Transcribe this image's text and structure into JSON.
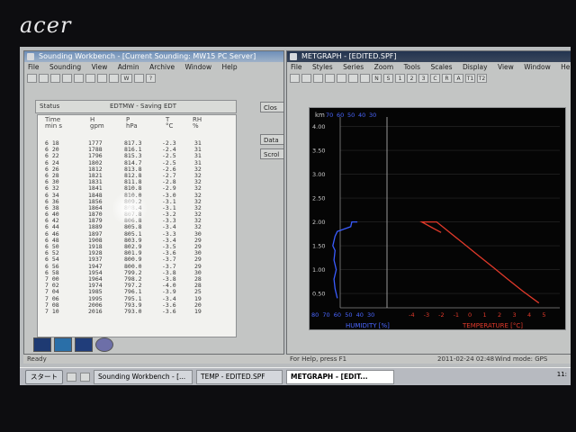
{
  "brand": "acer",
  "sounding": {
    "title": "Sounding Workbench - [Current Sounding: MW15 PC Server]",
    "menu": [
      "File",
      "Sounding",
      "View",
      "Admin",
      "Archive",
      "Window",
      "Help"
    ],
    "toolbar_w": "W",
    "status_label": "Status",
    "status_value": "EDTMW - Saving EDT",
    "buttons": {
      "close": "Clos",
      "data": "Data",
      "scroll": "Scrol"
    },
    "headers": {
      "time_top": "Time",
      "time_bot": "min  s",
      "h_top": "H",
      "h_bot": "gpm",
      "p_top": "P",
      "p_bot": "hPa",
      "t_top": "T",
      "t_bot": "°C",
      "rh_top": "RH",
      "rh_bot": "%"
    },
    "rows": [
      [
        "6 18",
        "1777",
        "817.3",
        "-2.3",
        "31"
      ],
      [
        "6 20",
        "1788",
        "816.1",
        "-2.4",
        "31"
      ],
      [
        "6 22",
        "1796",
        "815.3",
        "-2.5",
        "31"
      ],
      [
        "6 24",
        "1802",
        "814.7",
        "-2.5",
        "31"
      ],
      [
        "6 26",
        "1812",
        "813.8",
        "-2.6",
        "32"
      ],
      [
        "6 28",
        "1821",
        "812.8",
        "-2.7",
        "32"
      ],
      [
        "6 30",
        "1831",
        "811.8",
        "-2.8",
        "32"
      ],
      [
        "6 32",
        "1841",
        "810.8",
        "-2.9",
        "32"
      ],
      [
        "6 34",
        "1848",
        "810.0",
        "-3.0",
        "32"
      ],
      [
        "6 36",
        "1856",
        "809.2",
        "-3.1",
        "32"
      ],
      [
        "6 38",
        "1864",
        "808.4",
        "-3.1",
        "32"
      ],
      [
        "6 40",
        "1870",
        "807.8",
        "-3.2",
        "32"
      ],
      [
        "6 42",
        "1879",
        "806.8",
        "-3.3",
        "32"
      ],
      [
        "6 44",
        "1889",
        "805.8",
        "-3.4",
        "32"
      ],
      [
        "6 46",
        "1897",
        "805.1",
        "-3.3",
        "30"
      ],
      [
        "6 48",
        "1908",
        "803.9",
        "-3.4",
        "29"
      ],
      [
        "6 50",
        "1918",
        "802.9",
        "-3.5",
        "29"
      ],
      [
        "6 52",
        "1928",
        "801.9",
        "-3.6",
        "30"
      ],
      [
        "6 54",
        "1937",
        "800.9",
        "-3.7",
        "29"
      ],
      [
        "6 56",
        "1947",
        "800.0",
        "-3.7",
        "29"
      ],
      [
        "6 58",
        "1954",
        "799.2",
        "-3.8",
        "30"
      ],
      [
        "7 00",
        "1964",
        "798.2",
        "-3.8",
        "28"
      ],
      [
        "7 02",
        "1974",
        "797.2",
        "-4.0",
        "28"
      ],
      [
        "7 04",
        "1985",
        "796.1",
        "-3.9",
        "25"
      ],
      [
        "7 06",
        "1995",
        "795.1",
        "-3.4",
        "19"
      ],
      [
        "7 08",
        "2006",
        "793.9",
        "-3.6",
        "20"
      ],
      [
        "7 10",
        "2016",
        "793.0",
        "-3.6",
        "19"
      ]
    ]
  },
  "metgraph": {
    "title": "METGRAPH - [EDITED.SPF]",
    "menu": [
      "File",
      "Styles",
      "Series",
      "Zoom",
      "Tools",
      "Scales",
      "Display",
      "View",
      "Window",
      "Help"
    ],
    "toolbar": [
      "N",
      "S",
      "1",
      "2",
      "3",
      "C",
      "R",
      "A",
      "T1",
      "T2"
    ],
    "plot_mark": "km",
    "left_readout": [
      "70",
      "60",
      "50",
      "40",
      "30"
    ]
  },
  "chart_data": {
    "type": "line",
    "y_ticks": [
      "4.00",
      "3.50",
      "3.00",
      "2.50",
      "2.00",
      "1.50",
      "1.00",
      "0.50"
    ],
    "ylim": [
      0.2,
      4.2
    ],
    "humidity_ticks": [
      "80",
      "70",
      "60",
      "50",
      "40",
      "30"
    ],
    "humidity_lim": [
      80,
      30
    ],
    "xlabel_humidity": "HUMIDITY [%]",
    "temp_ticks": [
      "-4",
      "-3",
      "-2",
      "-1",
      "0",
      "1",
      "2",
      "3",
      "4",
      "5"
    ],
    "temp_lim": [
      -4.8,
      5.4
    ],
    "xlabel_temp": "TEMPERATURE [°C]",
    "series": [
      {
        "name": "HUMIDITY [%]",
        "color": "#3a5cff",
        "axis": "humidity",
        "points": [
          [
            60,
            0.4
          ],
          [
            62,
            0.6
          ],
          [
            63,
            0.8
          ],
          [
            61,
            1.0
          ],
          [
            63,
            1.2
          ],
          [
            62,
            1.4
          ],
          [
            64,
            1.5
          ],
          [
            62,
            1.7
          ],
          [
            60,
            1.8
          ],
          [
            48,
            1.9
          ],
          [
            47,
            2.0
          ],
          [
            42,
            2.0
          ]
        ]
      },
      {
        "name": "TEMPERATURE [°C]",
        "color": "#e0392a",
        "axis": "temp",
        "points": [
          [
            4.6,
            0.3
          ],
          [
            3.5,
            0.55
          ],
          [
            2.5,
            0.8
          ],
          [
            1.5,
            1.05
          ],
          [
            0.5,
            1.3
          ],
          [
            -0.5,
            1.55
          ],
          [
            -1.5,
            1.8
          ],
          [
            -2.3,
            2.0
          ],
          [
            -3.3,
            2.0
          ],
          [
            -2.6,
            1.88
          ],
          [
            -2.0,
            1.78
          ]
        ]
      }
    ]
  },
  "statusbar": {
    "ready": "Ready",
    "help": "For Help, press F1",
    "datetime": "2011-02-24 02:48",
    "wind": "Wind mode: GPS"
  },
  "taskbar": {
    "start": "スタート",
    "tasks": [
      "Sounding Workbench - [...",
      "TEMP - EDITED.SPF",
      "METGRAPH - [EDIT..."
    ],
    "clock": "11:"
  },
  "colors": {
    "humidity": "#3a5cff",
    "temperature": "#e0392a",
    "plot_bg": "#050505"
  }
}
